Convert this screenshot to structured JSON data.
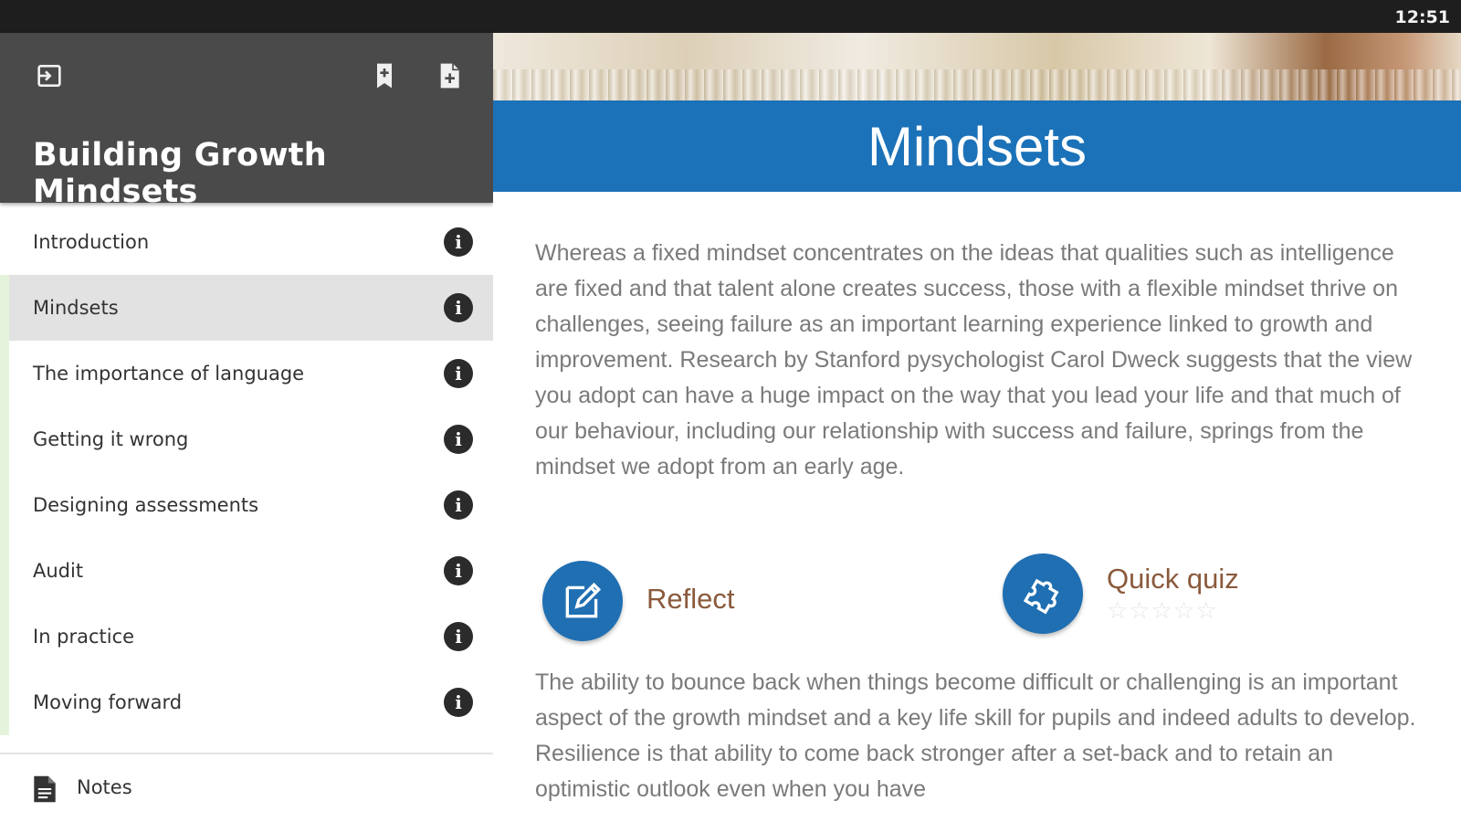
{
  "status_bar": {
    "time": "12:51"
  },
  "sidebar": {
    "title": "Building Growth Mindsets",
    "header_icons": [
      "exit-icon",
      "bookmark-add-icon",
      "document-add-icon"
    ],
    "items": [
      {
        "label": "Introduction",
        "active": false
      },
      {
        "label": "Mindsets",
        "active": true
      },
      {
        "label": "The importance of language",
        "active": false
      },
      {
        "label": "Getting it wrong",
        "active": false
      },
      {
        "label": "Designing assessments",
        "active": false
      },
      {
        "label": "Audit",
        "active": false
      },
      {
        "label": "In practice",
        "active": false
      },
      {
        "label": "Moving forward",
        "active": false
      }
    ],
    "notes_label": "Notes"
  },
  "content": {
    "title": "Mindsets",
    "paragraph1": "Whereas a fixed mindset concentrates on the ideas that qualities such as intelligence are fixed and that talent alone creates success, those with a flexible mindset thrive on challenges, seeing failure as an important learning experience linked to growth and improvement. Research by Stanford pysychologist Carol Dweck suggests that the view you adopt can have a huge impact on the way that you lead your life and that much of our behaviour, including our relationship with success and failure, springs from the mindset we adopt from an early age.",
    "reflect_label": "Reflect",
    "quiz_label": "Quick quiz",
    "quiz_rating": 0,
    "quiz_rating_max": 5,
    "stars": "☆☆☆☆☆",
    "paragraph2": "The ability to bounce back when things become difficult or challenging is an important aspect of the growth mindset and a key life skill for pupils and indeed adults to develop. Resilience is that ability to come back stronger after a set-back and to retain an optimistic outlook even when you have"
  },
  "colors": {
    "accent_blue": "#1c72b8",
    "sidebar_header": "#4a4a4a",
    "active_item": "#e2e2e2",
    "label_brown": "#8a5a3c",
    "progress_green": "#e6f3dc"
  }
}
